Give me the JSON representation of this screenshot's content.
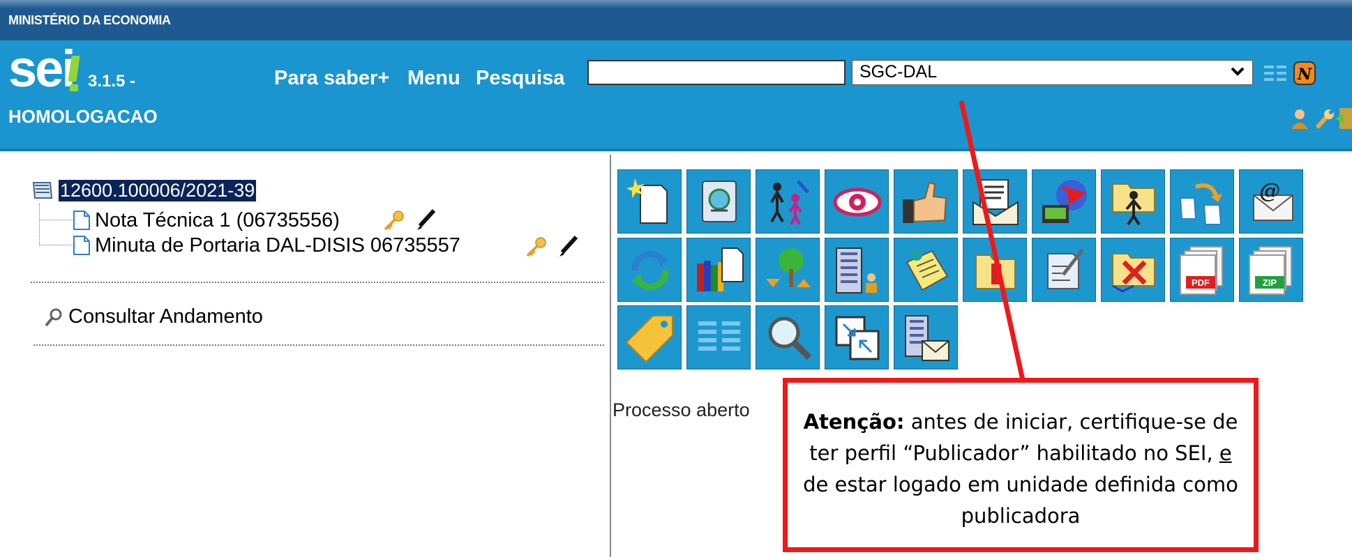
{
  "header": {
    "ministry": "MINISTÉRIO DA ECONOMIA",
    "logo": "sei",
    "version": "3.1.5 -",
    "environment": "HOMOLOGACAO",
    "nav": {
      "saber_mais": "Para saber+",
      "menu": "Menu",
      "pesquisa": "Pesquisa"
    },
    "search_value": "",
    "unit_selected": "SGC-DAL",
    "icons": [
      "list-icon",
      "new-badge-icon",
      "user-icon",
      "wrench-icon",
      "exit-icon"
    ]
  },
  "tree": {
    "process": "12600.100006/2021-39",
    "documents": [
      {
        "label": "Nota Técnica 1 (06735556)"
      },
      {
        "label": "Minuta de Portaria DAL-DISIS 06735557"
      }
    ],
    "consultar": "Consultar Andamento"
  },
  "toolbar": {
    "rows": [
      [
        "new-document-icon",
        "template-icon",
        "assign-icon",
        "view-icon",
        "thumbs-up-icon",
        "envelope-icon",
        "process-globe-icon",
        "person-folder-icon",
        "forward-icon",
        "email-icon"
      ],
      [
        "refresh-icon",
        "books-icon",
        "tree-icon",
        "building-person-icon",
        "note-icon",
        "folder-icon",
        "edit-document-icon",
        "remove-icon",
        "pdf-icon",
        "zip-icon"
      ],
      [
        "tag-icon",
        "list-view-icon",
        "search-icon",
        "split-icon",
        "building-envelope-icon"
      ]
    ]
  },
  "status": "Processo aberto",
  "callout": {
    "bold": "Atenção:",
    "text_1": " antes de iniciar, certifique-se de ter perfil “Publicador” habilitado no SEI, ",
    "underline": "e",
    "text_2": " de estar logado em unidade definida como publicadora",
    "border_color": "#f01818"
  }
}
